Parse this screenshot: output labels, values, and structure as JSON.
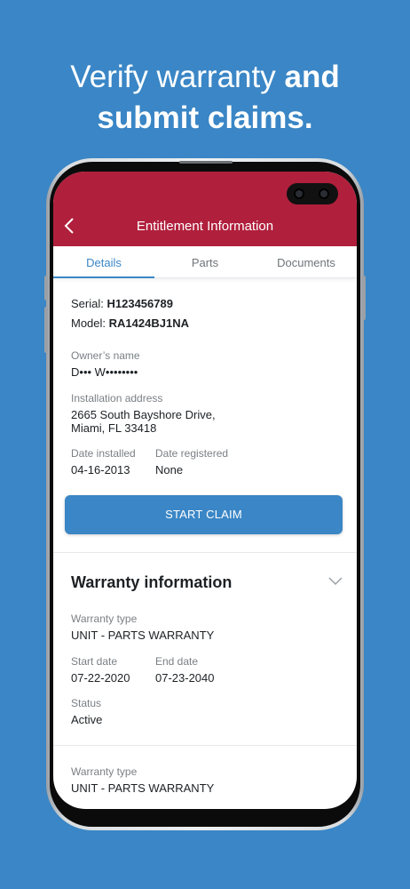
{
  "headline": {
    "normal": "Verify warranty ",
    "bold": "and submit claims."
  },
  "appbar": {
    "title": "Entitlement Information",
    "back_icon": "chevron-left-icon"
  },
  "tabs": [
    {
      "label": "Details",
      "active": true
    },
    {
      "label": "Parts",
      "active": false
    },
    {
      "label": "Documents",
      "active": false
    }
  ],
  "details": {
    "serial_label": "Serial:",
    "serial_value": "H123456789",
    "model_label": "Model:",
    "model_value": "RA1424BJ1NA",
    "owner_label": "Owner’s name",
    "owner_value": "D••• W••••••••",
    "address_label": "Installation address",
    "address_line1": "2665 South Bayshore Drive,",
    "address_line2": "Miami, FL 33418",
    "date_installed_label": "Date installed",
    "date_installed_value": "04-16-2013",
    "date_registered_label": "Date registered",
    "date_registered_value": "None",
    "start_claim_label": "START CLAIM"
  },
  "warranty": {
    "section_title": "Warranty information",
    "toggle_icon": "chevron-down-icon",
    "entries": [
      {
        "type_label": "Warranty type",
        "type_value": "UNIT - PARTS WARRANTY",
        "start_label": "Start date",
        "start_value": "07-22-2020",
        "end_label": "End date",
        "end_value": "07-23-2040",
        "status_label": "Status",
        "status_value": "Active"
      },
      {
        "type_label": "Warranty type",
        "type_value": "UNIT - PARTS WARRANTY"
      }
    ]
  },
  "colors": {
    "background": "#3a86c6",
    "appbar": "#b01f3c",
    "accent": "#3a86c6"
  }
}
